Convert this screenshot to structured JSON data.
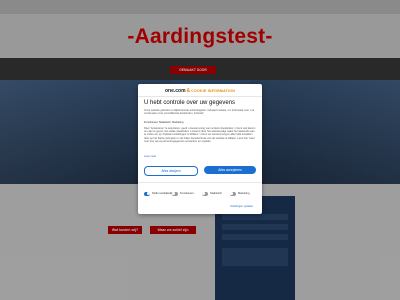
{
  "site": {
    "title": "-Aardingstest-",
    "nav_button": "Gemaakt door"
  },
  "page": {
    "link1": "Wat kosten wij?",
    "link2": "Waar we actief zijn"
  },
  "consent": {
    "brand_left": "one.com",
    "brand_amp": "&",
    "brand_right": "COOKIE INFORMATION",
    "title": "U hebt controle over uw gegevens",
    "intro": "Onze website gebruikt en bijbehorende technologieën, inclusief cookies, om informatie over u te verzamelen voor verschillende doeleinden, inclusief:",
    "purposes": "Functioneel, Statistisch, Marketing",
    "details": "Door 'Accepteren' te selecteren, geeft u toestemming voor al deze doeleinden. U kunt ook kiezen om aan te geven met welke doeleinden u instemt door het selectievakje naast het doeleinde aan te vinken en op 'Opslaan instellingen' te klikken. U kunt uw toestemming te allen tijde intrekken door op het kleine pictogram in de linker benedenhoek van de website te klikken. Lees hier meer over hoe wij uw persoonsgegevens verwerken en opslaan.",
    "more_link": "Lees meer",
    "reject_label": "Alles afwijzen",
    "accept_label": "Alles accepteren",
    "toggles": [
      {
        "label": "Strikt noodzakelijk",
        "on": true
      },
      {
        "label": "Functioneel",
        "on": false
      },
      {
        "label": "Statistisch",
        "on": false
      },
      {
        "label": "Marketing",
        "on": false
      }
    ],
    "save_label": "Instellingen opslaan"
  },
  "colors": {
    "accent": "#1a6fd1",
    "brand_red": "#e00000",
    "hero": "#2f4a6c"
  }
}
